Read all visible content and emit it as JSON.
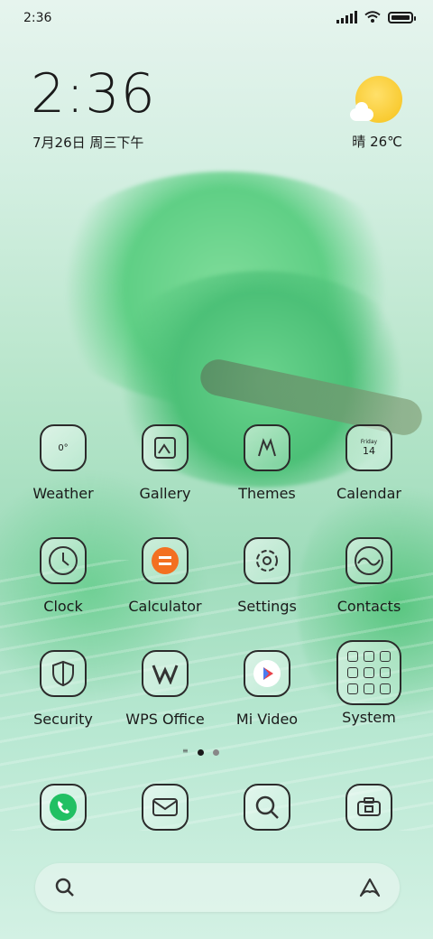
{
  "status_bar": {
    "time": "2:36",
    "icons": [
      "signal-icon",
      "wifi-icon",
      "battery-icon"
    ]
  },
  "clock_widget": {
    "time": "2:36",
    "date": "7月26日 周三下午"
  },
  "weather_widget": {
    "condition": "晴",
    "temperature": "26℃",
    "icon": "sunny-cloud-icon",
    "text": "晴 26℃"
  },
  "apps": [
    {
      "label": "Weather",
      "icon": "weather-icon",
      "icon_text": "0°"
    },
    {
      "label": "Gallery",
      "icon": "gallery-icon"
    },
    {
      "label": "Themes",
      "icon": "themes-icon"
    },
    {
      "label": "Calendar",
      "icon": "calendar-icon",
      "icon_day": "Friday",
      "icon_date": "14"
    },
    {
      "label": "Clock",
      "icon": "clock-icon"
    },
    {
      "label": "Calculator",
      "icon": "calculator-icon"
    },
    {
      "label": "Settings",
      "icon": "settings-icon"
    },
    {
      "label": "Contacts",
      "icon": "contacts-icon"
    },
    {
      "label": "Security",
      "icon": "security-shield-icon"
    },
    {
      "label": "WPS Office",
      "icon": "wps-office-icon"
    },
    {
      "label": "Mi Video",
      "icon": "mi-video-icon"
    },
    {
      "label": "System",
      "icon": "folder-icon"
    }
  ],
  "page_indicator": {
    "pages": 2,
    "current": 1
  },
  "dock": [
    {
      "name": "phone",
      "icon": "phone-icon"
    },
    {
      "name": "messages",
      "icon": "messages-icon"
    },
    {
      "name": "browser",
      "icon": "search-browser-icon"
    },
    {
      "name": "camera",
      "icon": "camera-icon"
    }
  ],
  "search_bar": {
    "left_icon": "search-icon",
    "right_icon": "assistant-icon"
  },
  "colors": {
    "accent_green": "#21c063",
    "weather_sun": "#f6c21a",
    "calculator_orange": "#f37021"
  }
}
